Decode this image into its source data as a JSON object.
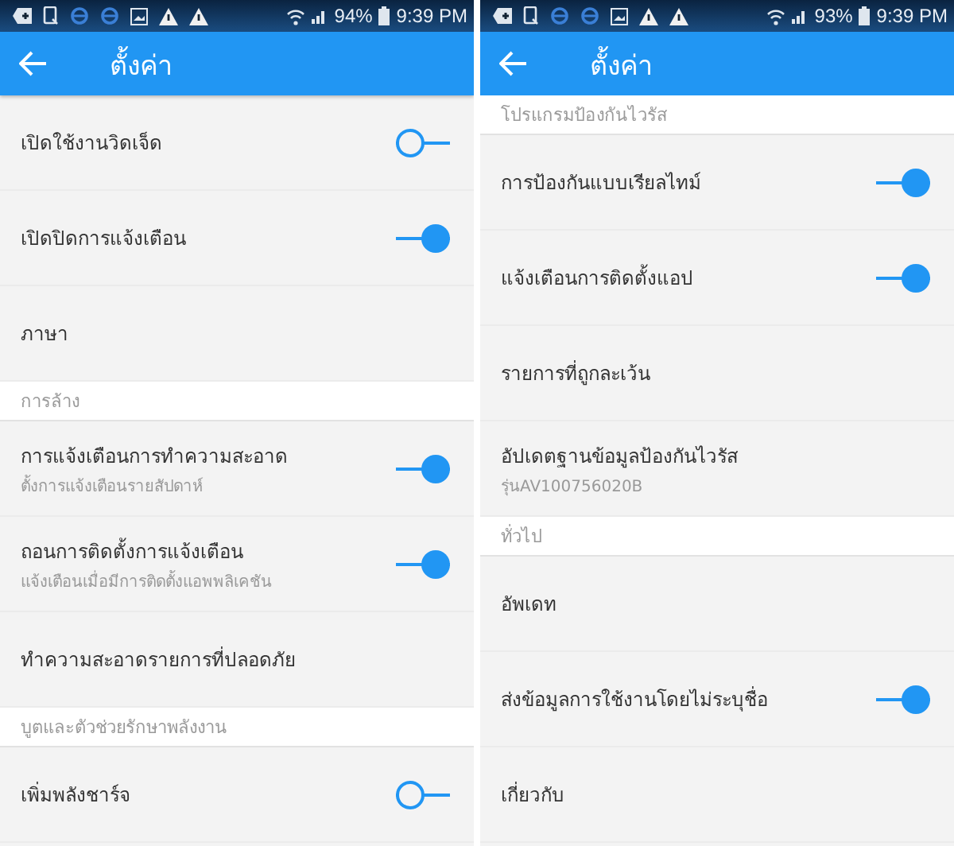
{
  "screens": [
    {
      "status_bar": {
        "battery": "94%",
        "time": "9:39 PM"
      },
      "app_bar": {
        "title": "ตั้งค่า"
      },
      "items": [
        {
          "kind": "toggle",
          "label": "เปิดใช้งานวิดเจ็ด",
          "on": false
        },
        {
          "kind": "toggle",
          "label": "เปิดปิดการแจ้งเตือน",
          "on": true
        },
        {
          "kind": "plain",
          "label": "ภาษา"
        },
        {
          "kind": "header",
          "label": "การล้าง"
        },
        {
          "kind": "toggle",
          "label": "การแจ้งเตือนการทำความสะอาด",
          "sublabel": "ตั้งการแจ้งเตือนรายสัปดาห์",
          "on": true
        },
        {
          "kind": "toggle",
          "label": "ถอนการติดตั้งการแจ้งเตือน",
          "sublabel": "แจ้งเตือนเมื่อมีการติดตั้งแอพพลิเคชัน",
          "on": true
        },
        {
          "kind": "plain",
          "label": "ทำความสะอาดรายการที่ปลอดภัย"
        },
        {
          "kind": "header",
          "label": "บูตและตัวช่วยรักษาพลังงาน"
        },
        {
          "kind": "toggle",
          "label": "เพิ่มพลังชาร์จ",
          "on": false
        }
      ]
    },
    {
      "status_bar": {
        "battery": "93%",
        "time": "9:39 PM"
      },
      "app_bar": {
        "title": "ตั้งค่า"
      },
      "items": [
        {
          "kind": "header",
          "label": "โปรแกรมป้องกันไวรัส"
        },
        {
          "kind": "toggle",
          "label": "การป้องกันแบบเรียลไทม์",
          "on": true
        },
        {
          "kind": "toggle",
          "label": "แจ้งเตือนการติดตั้งแอป",
          "on": true
        },
        {
          "kind": "plain",
          "label": "รายการที่ถูกละเว้น"
        },
        {
          "kind": "plain",
          "label": "อัปเดตฐานข้อมูลป้องกันไวรัส",
          "sublabel": "รุ่นAV100756020B"
        },
        {
          "kind": "header",
          "label": "ทั่วไป"
        },
        {
          "kind": "plain",
          "label": "อัพเดท"
        },
        {
          "kind": "toggle",
          "label": "ส่งข้อมูลการใช้งานโดยไม่ระบุชื่อ",
          "on": true
        },
        {
          "kind": "plain",
          "label": "เกี่ยวกับ"
        }
      ]
    }
  ]
}
